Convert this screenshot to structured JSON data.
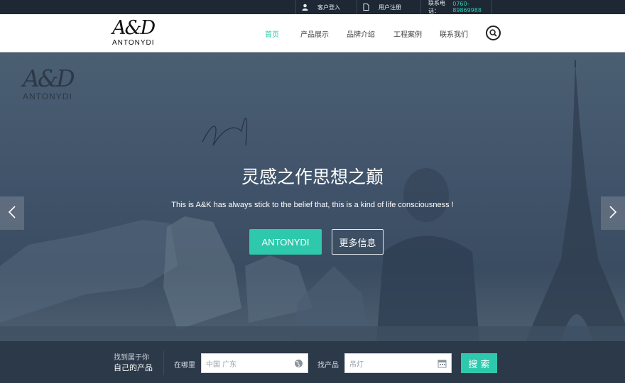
{
  "topbar": {
    "login_label": "客户登入",
    "register_label": "用户注册",
    "phone_label": "联系电话：",
    "phone_number": "0760-89869988"
  },
  "brand": {
    "logo_mark": "A&D",
    "logo_word": "ANTONYDI"
  },
  "nav": {
    "items": [
      {
        "label": "首页",
        "active": true
      },
      {
        "label": "产品展示",
        "active": false
      },
      {
        "label": "品牌介绍",
        "active": false
      },
      {
        "label": "工程案例",
        "active": false
      },
      {
        "label": "联系我们",
        "active": false
      }
    ]
  },
  "hero": {
    "watermark_mark": "A&D",
    "watermark_word": "ANTONYDI",
    "signature": "Antonydi",
    "title": "灵感之作思想之巅",
    "subtitle": "This is A&K has always stick to the belief that, this is a kind of life consciousness !",
    "primary_button": "ANTONYDI",
    "secondary_button": "更多信息"
  },
  "finder": {
    "slogan_line1": "找到属于你",
    "slogan_line2": "自己的产品",
    "where_label": "在哪里",
    "where_placeholder": "中国 广东",
    "product_label": "找产品",
    "product_placeholder": "吊灯",
    "search_button": "搜 索"
  },
  "colors": {
    "accent": "#2ec9ad",
    "topbar_bg": "#1e2835",
    "hero_overlay": "#40536a",
    "finder_bg": "#2b3949"
  }
}
